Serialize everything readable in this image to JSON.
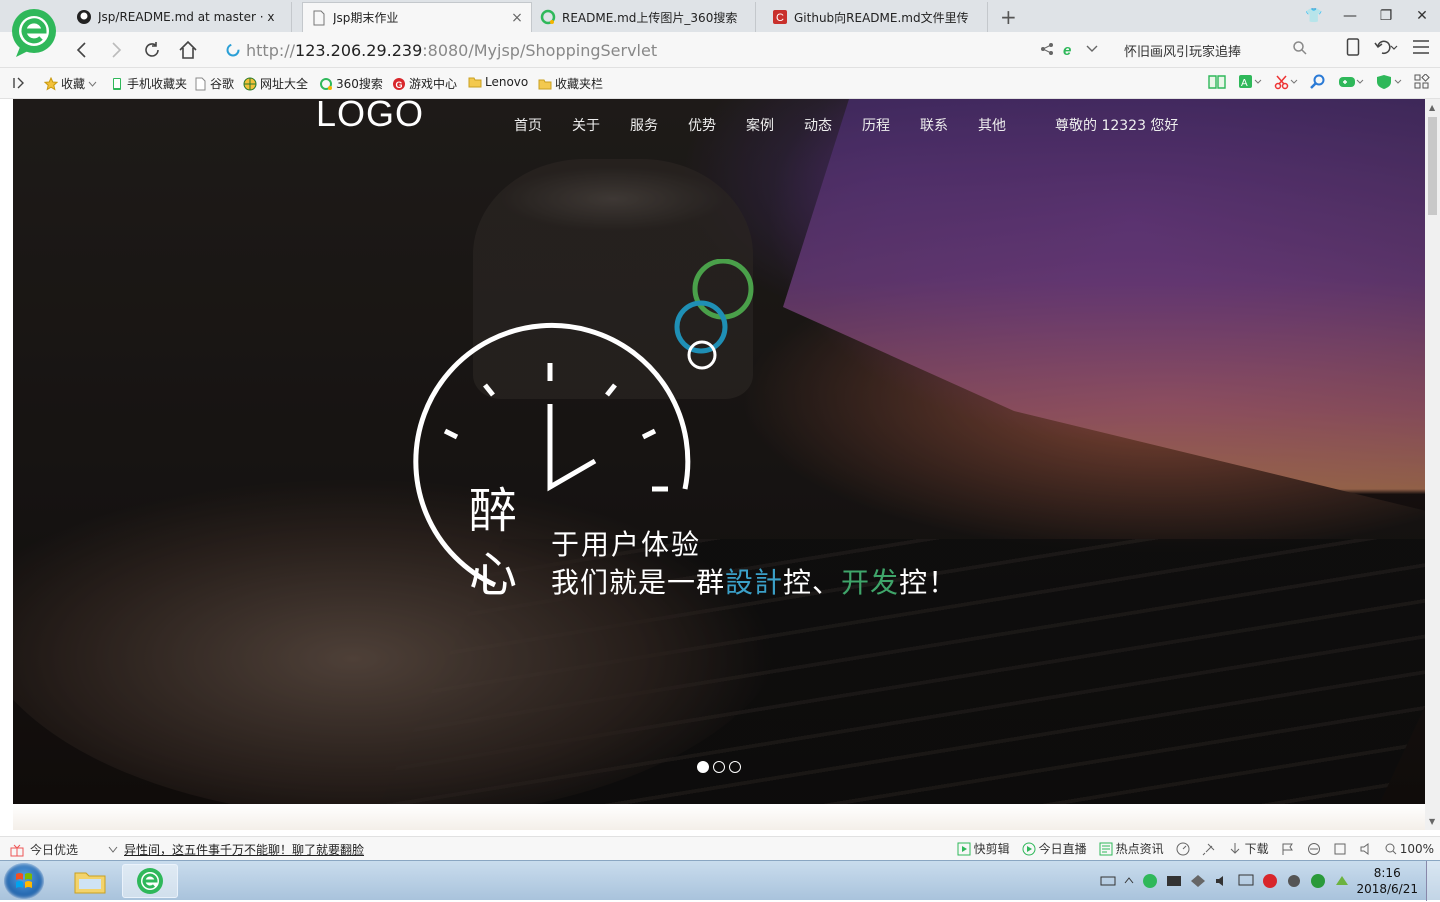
{
  "browser": {
    "tabs": [
      {
        "label": "Jsp/README.md at master · x",
        "active": false,
        "icon": "github-icon"
      },
      {
        "label": "Jsp期末作业",
        "active": true,
        "icon": "page-icon"
      },
      {
        "label": "README.md上传图片_360搜索",
        "active": false,
        "icon": "360-search-icon"
      },
      {
        "label": "Github向README.md文件里传",
        "active": false,
        "icon": "csdn-icon"
      }
    ],
    "close_tab": "×",
    "new_tab": "+",
    "url_prefix": "http://",
    "url_host": "123.206.29.239",
    "url_rest": ":8080/Myjsp/ShoppingServlet",
    "search_text": "怀旧画风引玩家追捧",
    "bookmarks": [
      {
        "label": "收藏",
        "icon": "star-icon"
      },
      {
        "label": "手机收藏夹",
        "icon": "phone-icon"
      },
      {
        "label": "谷歌",
        "icon": "page-icon"
      },
      {
        "label": "网址大全",
        "icon": "globe-icon"
      },
      {
        "label": "360搜索",
        "icon": "360-search-icon"
      },
      {
        "label": "游戏中心",
        "icon": "game-icon"
      },
      {
        "label": "Lenovo",
        "icon": "folder-icon"
      },
      {
        "label": "收藏夹栏",
        "icon": "folder-icon"
      }
    ]
  },
  "site": {
    "logo": "LOGO",
    "nav": [
      "首页",
      "关于",
      "服务",
      "优势",
      "案例",
      "动态",
      "历程",
      "联系",
      "其他"
    ],
    "greeting": "尊敬的 12323 您好",
    "hero": {
      "char1": "醉",
      "char2": "心",
      "line1": "于用户体验",
      "line2_a": "我们就是一群",
      "line2_b": "設計",
      "line2_c": "控、",
      "line2_d": "开发",
      "line2_e": "控！"
    },
    "slides": {
      "count": 3,
      "active": 1
    }
  },
  "statusbar": {
    "today_pick": "今日优选",
    "news": "异性间，这五件事千万不能聊！聊了就要翻脸",
    "items": [
      "快剪辑",
      "今日直播",
      "热点资讯",
      "下载"
    ],
    "zoom": "100%"
  },
  "taskbar": {
    "time": "8:16",
    "date": "2018/6/21"
  },
  "colors": {
    "accent_blue": "#3ba0c8",
    "accent_green": "#3fa56a",
    "browser_green": "#2fb85a"
  }
}
